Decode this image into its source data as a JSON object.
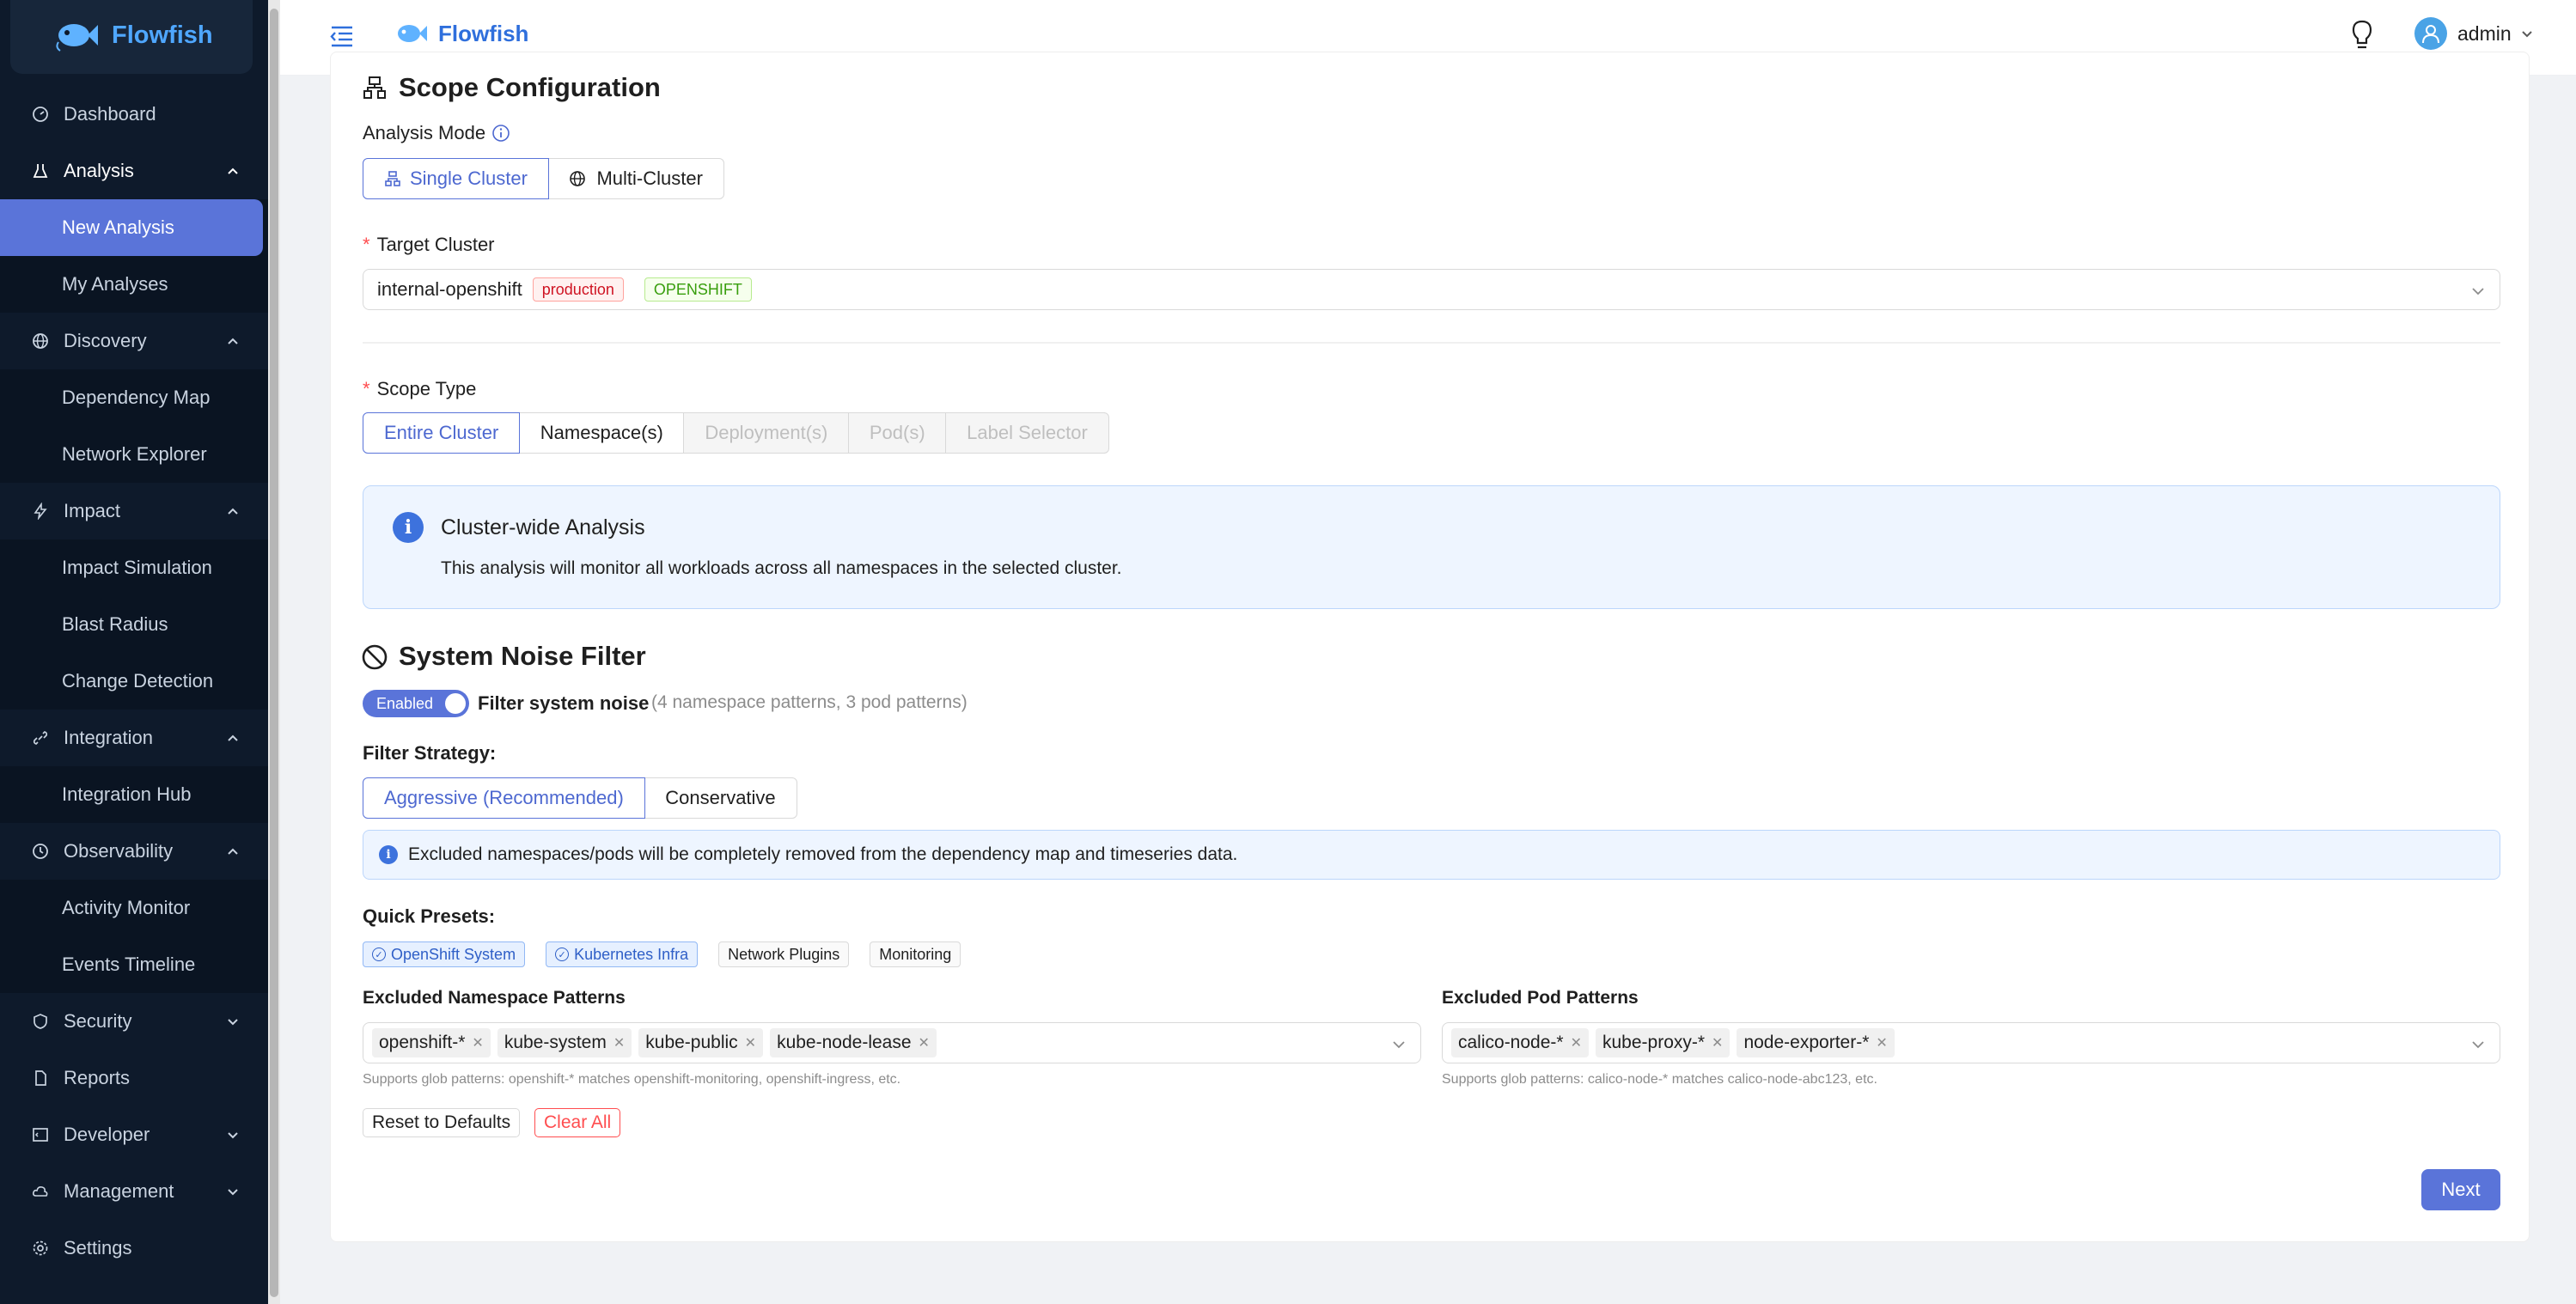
{
  "app": {
    "name": "Flowfish"
  },
  "sidebar": {
    "items": [
      {
        "label": "Dashboard",
        "icon": "dashboard-icon"
      },
      {
        "label": "Analysis",
        "icon": "flask-icon",
        "open": true,
        "children": [
          "New Analysis",
          "My Analyses"
        ]
      },
      {
        "label": "Discovery",
        "icon": "globe-icon",
        "open": true,
        "children": [
          "Dependency Map",
          "Network Explorer"
        ]
      },
      {
        "label": "Impact",
        "icon": "lightning-icon",
        "open": true,
        "children": [
          "Impact Simulation",
          "Blast Radius",
          "Change Detection"
        ]
      },
      {
        "label": "Integration",
        "icon": "link-icon",
        "open": true,
        "children": [
          "Integration Hub"
        ]
      },
      {
        "label": "Observability",
        "icon": "clock-icon",
        "open": true,
        "children": [
          "Activity Monitor",
          "Events Timeline"
        ]
      },
      {
        "label": "Security",
        "icon": "shield-icon",
        "open": false
      },
      {
        "label": "Reports",
        "icon": "file-icon",
        "open": false
      },
      {
        "label": "Developer",
        "icon": "code-icon",
        "open": false
      },
      {
        "label": "Management",
        "icon": "cloud-icon",
        "open": false
      },
      {
        "label": "Settings",
        "icon": "gear-icon",
        "open": false
      }
    ],
    "active": "New Analysis"
  },
  "header": {
    "brand": "Flowfish",
    "user": "admin"
  },
  "scope": {
    "title": "Scope Configuration",
    "analysis_mode_label": "Analysis Mode",
    "modes": [
      "Single Cluster",
      "Multi-Cluster"
    ],
    "target_cluster_label": "Target Cluster",
    "cluster_name": "internal-openshift",
    "cluster_env_tag": "production",
    "cluster_type_tag": "OPENSHIFT",
    "scope_type_label": "Scope Type",
    "scope_types": [
      "Entire Cluster",
      "Namespace(s)",
      "Deployment(s)",
      "Pod(s)",
      "Label Selector"
    ],
    "info_title": "Cluster-wide Analysis",
    "info_text": "This analysis will monitor all workloads across all namespaces in the selected cluster."
  },
  "noise": {
    "title": "System Noise Filter",
    "toggle_label": "Enabled",
    "filter_label": "Filter system noise",
    "filter_count": "(4 namespace patterns, 3 pod patterns)",
    "strategy_label": "Filter Strategy:",
    "strategies": [
      "Aggressive (Recommended)",
      "Conservative"
    ],
    "strategy_info": "Excluded namespaces/pods will be completely removed from the dependency map and timeseries data.",
    "presets_label": "Quick Presets:",
    "presets": [
      {
        "label": "OpenShift System",
        "selected": true
      },
      {
        "label": "Kubernetes Infra",
        "selected": true
      },
      {
        "label": "Network Plugins",
        "selected": false
      },
      {
        "label": "Monitoring",
        "selected": false
      }
    ],
    "ns_label": "Excluded Namespace Patterns",
    "ns_patterns": [
      "openshift-*",
      "kube-system",
      "kube-public",
      "kube-node-lease"
    ],
    "ns_hint": "Supports glob patterns: openshift-* matches openshift-monitoring, openshift-ingress, etc.",
    "pod_label": "Excluded Pod Patterns",
    "pod_patterns": [
      "calico-node-*",
      "kube-proxy-*",
      "node-exporter-*"
    ],
    "pod_hint": "Supports glob patterns: calico-node-* matches calico-node-abc123, etc.",
    "reset_label": "Reset to Defaults",
    "clear_label": "Clear All"
  },
  "footer": {
    "next_label": "Next"
  },
  "colors": {
    "primary": "#5a74d9",
    "sidebar_bg": "#0e1a2b",
    "danger": "#ff4d4f"
  }
}
